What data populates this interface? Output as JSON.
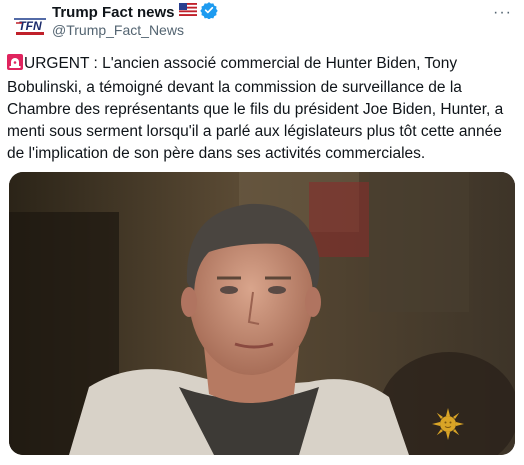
{
  "account": {
    "display_name": "Trump Fact news",
    "handle": "@Trump_Fact_News",
    "avatar_text": "TFN"
  },
  "tweet": {
    "text": "URGENT : L'ancien associé commercial de Hunter Biden, Tony Bobulinski, a témoigné devant la commission de surveillance de la Chambre des représentants que le fils du président Joe Biden, Hunter, a menti sous serment lorsqu'il a parlé aux législateurs plus tôt cette année de l'implication de son père dans ses activités commerciales."
  },
  "icons": {
    "flag": "us-flag-icon",
    "verified": "verified-badge-icon",
    "more": "more-options-icon",
    "siren": "siren-icon",
    "broadcaster": "sun-logo-icon"
  },
  "colors": {
    "verified": "#1d9bf0",
    "text": "#0f1419",
    "secondary": "#536471",
    "siren": "#e0245e"
  }
}
